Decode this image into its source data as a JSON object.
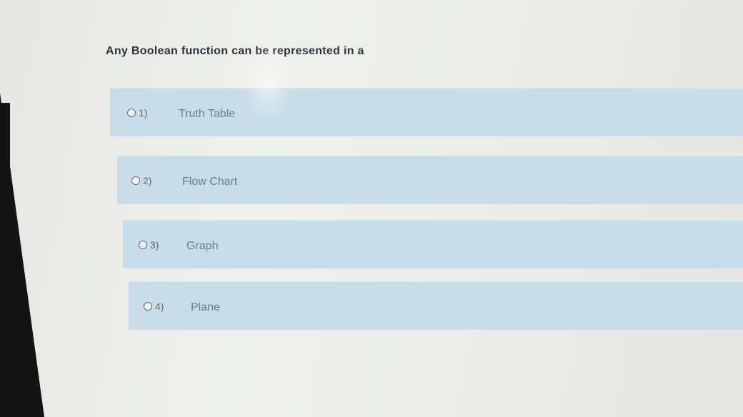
{
  "question": {
    "text": "Any Boolean function can be represented in a"
  },
  "options": [
    {
      "number": "1)",
      "label": "Truth Table"
    },
    {
      "number": "2)",
      "label": "Flow Chart"
    },
    {
      "number": "3)",
      "label": "Graph"
    },
    {
      "number": "4)",
      "label": "Plane"
    }
  ],
  "colors": {
    "option_background": "#c9dde9",
    "option_text": "#627f91",
    "question_text": "#2e3338"
  }
}
